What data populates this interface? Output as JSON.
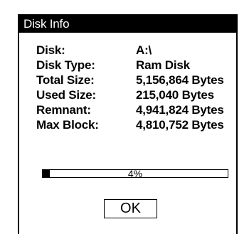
{
  "dialog": {
    "title": "Disk Info",
    "rows": [
      {
        "label": "Disk:",
        "value": "A:\\"
      },
      {
        "label": "Disk Type:",
        "value": "Ram Disk"
      },
      {
        "label": "Total Size:",
        "value": "5,156,864 Bytes"
      },
      {
        "label": "Used Size:",
        "value": "215,040 Bytes"
      },
      {
        "label": "Remnant:",
        "value": "4,941,824 Bytes"
      },
      {
        "label": "Max Block:",
        "value": "4,810,752 Bytes"
      }
    ],
    "usage": {
      "percent_value": 4,
      "percent_text": "4%"
    },
    "ok_label": "OK"
  }
}
